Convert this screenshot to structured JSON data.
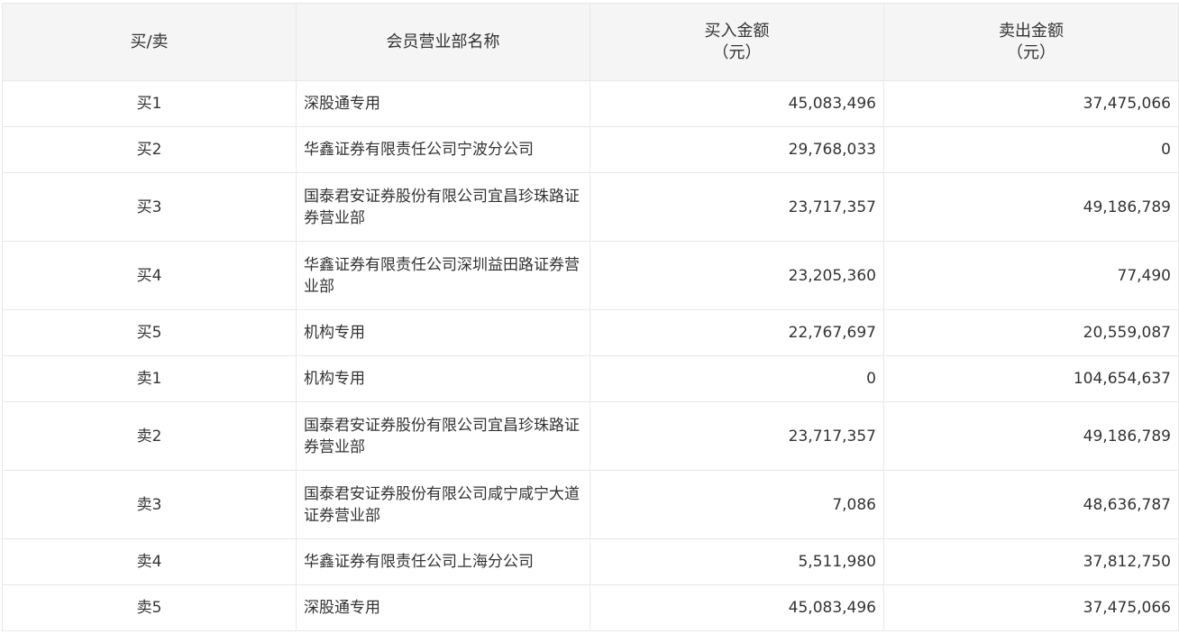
{
  "table": {
    "headers": {
      "side": "买/卖",
      "branch": "会员营业部名称",
      "buy": "买入金额",
      "buy_unit": "（元）",
      "sell": "卖出金额",
      "sell_unit": "（元）"
    },
    "rows": [
      {
        "side": "买1",
        "name": "深股通专用",
        "buy": "45,083,496",
        "sell": "37,475,066"
      },
      {
        "side": "买2",
        "name": "华鑫证券有限责任公司宁波分公司",
        "buy": "29,768,033",
        "sell": "0"
      },
      {
        "side": "买3",
        "name": "国泰君安证券股份有限公司宜昌珍珠路证券营业部",
        "buy": "23,717,357",
        "sell": "49,186,789"
      },
      {
        "side": "买4",
        "name": "华鑫证券有限责任公司深圳益田路证券营业部",
        "buy": "23,205,360",
        "sell": "77,490"
      },
      {
        "side": "买5",
        "name": "机构专用",
        "buy": "22,767,697",
        "sell": "20,559,087"
      },
      {
        "side": "卖1",
        "name": "机构专用",
        "buy": "0",
        "sell": "104,654,637"
      },
      {
        "side": "卖2",
        "name": "国泰君安证券股份有限公司宜昌珍珠路证券营业部",
        "buy": "23,717,357",
        "sell": "49,186,789"
      },
      {
        "side": "卖3",
        "name": "国泰君安证券股份有限公司咸宁咸宁大道证券营业部",
        "buy": "7,086",
        "sell": "48,636,787"
      },
      {
        "side": "卖4",
        "name": "华鑫证券有限责任公司上海分公司",
        "buy": "5,511,980",
        "sell": "37,812,750"
      },
      {
        "side": "卖5",
        "name": "深股通专用",
        "buy": "45,083,496",
        "sell": "37,475,066"
      }
    ]
  }
}
